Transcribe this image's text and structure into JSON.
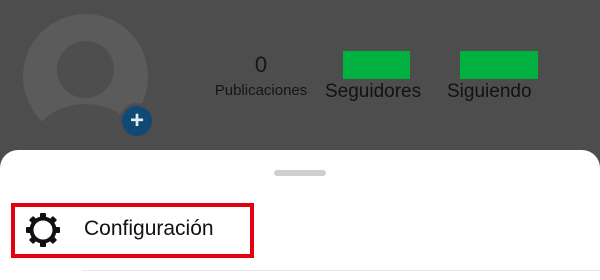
{
  "profile": {
    "posts_count": "0",
    "posts_label": "Publicaciones",
    "followers_label": "Seguidores",
    "following_label": "Siguiendo",
    "add_icon": "plus-icon",
    "avatar_icon": "default-avatar-icon"
  },
  "redaction_color": "#00b140",
  "sheet": {
    "menu_items": [
      {
        "label": "Configuración",
        "icon": "gear-icon",
        "highlighted": true
      }
    ],
    "highlight_color": "#e3000f"
  }
}
